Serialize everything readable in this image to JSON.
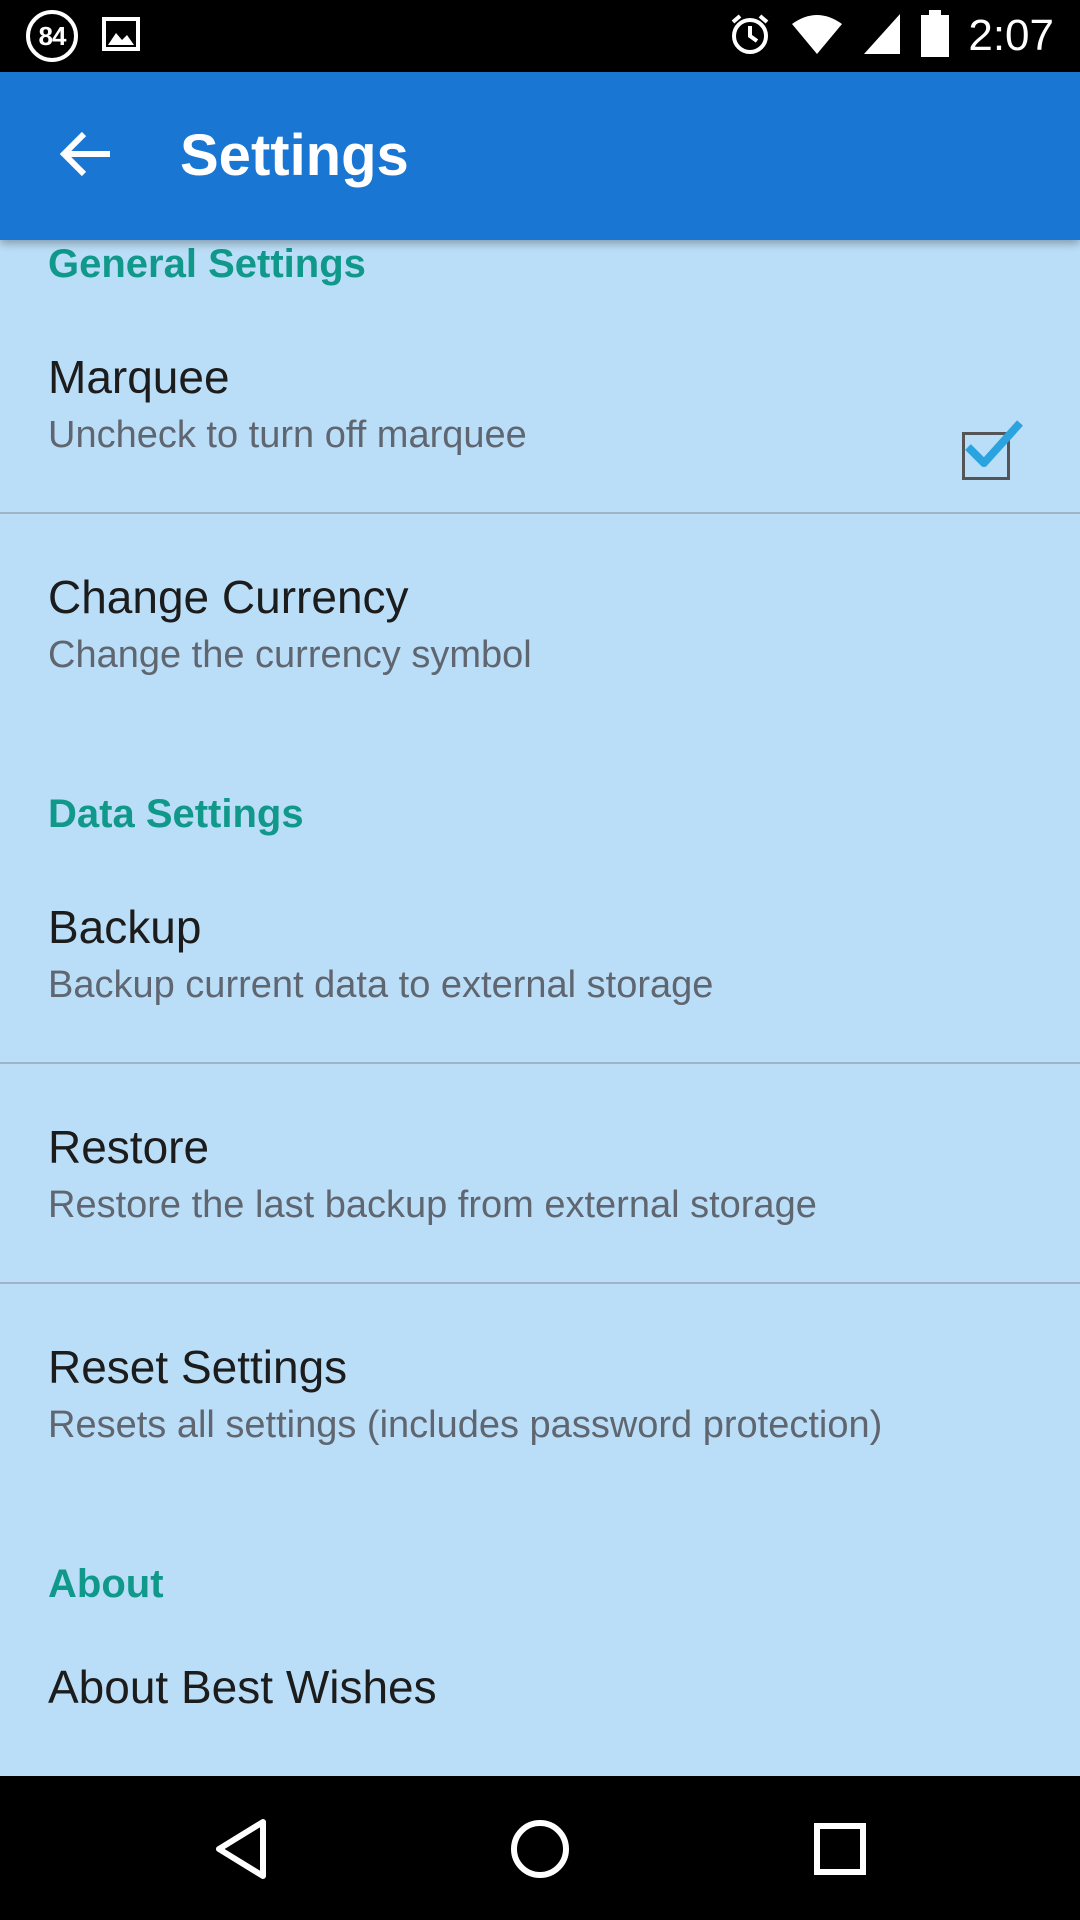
{
  "status_bar": {
    "notification_count": "84",
    "time": "2:07",
    "icons": [
      "image-icon",
      "alarm-icon",
      "wifi-icon",
      "signal-icon",
      "battery-icon"
    ]
  },
  "app_bar": {
    "title": "Settings",
    "back_icon": "arrow-back-icon",
    "color": "#1976d2"
  },
  "sections": {
    "general": {
      "header": "General Settings",
      "marquee": {
        "title": "Marquee",
        "summary": "Uncheck to turn off marquee",
        "checked": true
      },
      "currency": {
        "title": "Change Currency",
        "summary": "Change the currency symbol"
      }
    },
    "data": {
      "header": "Data Settings",
      "backup": {
        "title": "Backup",
        "summary": "Backup current data to external storage"
      },
      "restore": {
        "title": "Restore",
        "summary": "Restore the last backup from external storage"
      },
      "reset": {
        "title": "Reset Settings",
        "summary": "Resets all settings (includes password protection)"
      }
    },
    "about": {
      "header": "About",
      "about_app": {
        "title": "About Best Wishes"
      }
    }
  },
  "colors": {
    "background": "#bbdef8",
    "section_header": "#10988a",
    "check_accent": "#2aa3de"
  },
  "nav_bar": {
    "icons": [
      "back-triangle-icon",
      "home-circle-icon",
      "recents-square-icon"
    ]
  }
}
